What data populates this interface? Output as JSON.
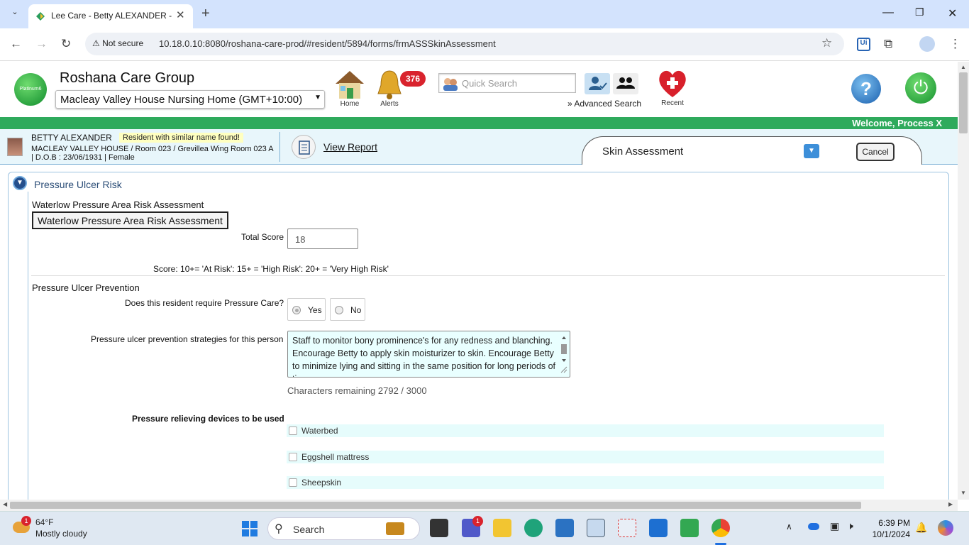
{
  "browser": {
    "tab_title": "Lee Care - Betty ALEXANDER - Skin Assessment",
    "new_tab": "+",
    "not_secure": "Not secure",
    "url": "10.18.0.10:8080/roshana-care-prod/#resident/5894/forms/frmASSSkinAssessment"
  },
  "header": {
    "logo_text": "Platinum6",
    "org_name": "Roshana Care Group",
    "facility": "Macleay Valley House Nursing Home (GMT+10:00)",
    "home_label": "Home",
    "alerts_label": "Alerts",
    "alerts_count": "376",
    "quick_search_placeholder": "Quick Search",
    "advanced_search": "» Advanced Search",
    "recent_label": "Recent",
    "welcome": "Welcome, Process X"
  },
  "resident": {
    "name": "BETTY ALEXANDER",
    "warning": "Resident with similar name found!",
    "details_line1": "MACLEAY VALLEY HOUSE / Room 023 / Grevillea Wing Room 023 A",
    "details_line2": "| D.O.B : 23/06/1931 | Female",
    "view_report": "View Report"
  },
  "form": {
    "name": "Skin Assessment",
    "cancel": "Cancel",
    "panel_title": "Pressure Ulcer Risk",
    "waterlow_heading": "Waterlow Pressure Area Risk Assessment",
    "waterlow_button": "Waterlow Pressure Area Risk Assessment",
    "total_score_label": "Total Score",
    "total_score": "18",
    "score_legend": "Score: 10+= 'At Risk': 15+ = 'High Risk': 20+ = 'Very High Risk'",
    "prevention_heading": "Pressure Ulcer Prevention",
    "require_question": "Does this resident require Pressure Care?",
    "yes": "Yes",
    "no": "No",
    "strategies_label": "Pressure ulcer prevention strategies for this person",
    "strategies_text": "Staff to monitor bony prominence's for any redness and blanching. Encourage Betty to apply skin moisturizer to skin. Encourage Betty to minimize lying and sitting in the same position for long periods of time.",
    "chars_remaining": "Characters remaining 2792 / 3000",
    "devices_label": "Pressure relieving devices to be used",
    "devices": [
      "Waterbed",
      "Eggshell mattress",
      "Sheepskin"
    ]
  },
  "taskbar": {
    "weather_badge": "1",
    "temp": "64°F",
    "condition": "Mostly cloudy",
    "search": "Search",
    "teams_badge": "1",
    "time": "6:39 PM",
    "date": "10/1/2024"
  },
  "colors": {
    "green_bar": "#2eaa5c",
    "resident_bar": "#e8f6fb",
    "accent_blue": "#3d8fd9"
  }
}
